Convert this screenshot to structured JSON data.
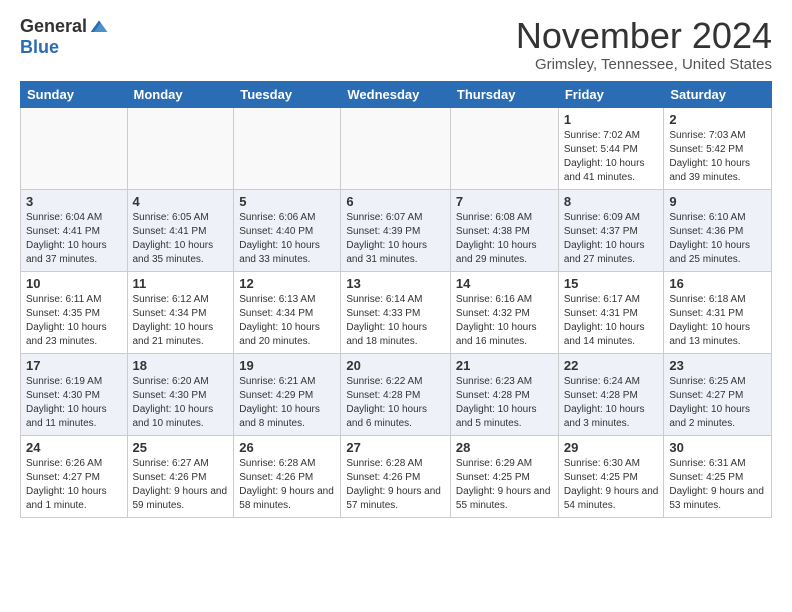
{
  "header": {
    "logo_general": "General",
    "logo_blue": "Blue",
    "month_title": "November 2024",
    "location": "Grimsley, Tennessee, United States"
  },
  "weekdays": [
    "Sunday",
    "Monday",
    "Tuesday",
    "Wednesday",
    "Thursday",
    "Friday",
    "Saturday"
  ],
  "weeks": [
    [
      {
        "day": "",
        "info": ""
      },
      {
        "day": "",
        "info": ""
      },
      {
        "day": "",
        "info": ""
      },
      {
        "day": "",
        "info": ""
      },
      {
        "day": "",
        "info": ""
      },
      {
        "day": "1",
        "info": "Sunrise: 7:02 AM\nSunset: 5:44 PM\nDaylight: 10 hours and 41 minutes."
      },
      {
        "day": "2",
        "info": "Sunrise: 7:03 AM\nSunset: 5:42 PM\nDaylight: 10 hours and 39 minutes."
      }
    ],
    [
      {
        "day": "3",
        "info": "Sunrise: 6:04 AM\nSunset: 4:41 PM\nDaylight: 10 hours and 37 minutes."
      },
      {
        "day": "4",
        "info": "Sunrise: 6:05 AM\nSunset: 4:41 PM\nDaylight: 10 hours and 35 minutes."
      },
      {
        "day": "5",
        "info": "Sunrise: 6:06 AM\nSunset: 4:40 PM\nDaylight: 10 hours and 33 minutes."
      },
      {
        "day": "6",
        "info": "Sunrise: 6:07 AM\nSunset: 4:39 PM\nDaylight: 10 hours and 31 minutes."
      },
      {
        "day": "7",
        "info": "Sunrise: 6:08 AM\nSunset: 4:38 PM\nDaylight: 10 hours and 29 minutes."
      },
      {
        "day": "8",
        "info": "Sunrise: 6:09 AM\nSunset: 4:37 PM\nDaylight: 10 hours and 27 minutes."
      },
      {
        "day": "9",
        "info": "Sunrise: 6:10 AM\nSunset: 4:36 PM\nDaylight: 10 hours and 25 minutes."
      }
    ],
    [
      {
        "day": "10",
        "info": "Sunrise: 6:11 AM\nSunset: 4:35 PM\nDaylight: 10 hours and 23 minutes."
      },
      {
        "day": "11",
        "info": "Sunrise: 6:12 AM\nSunset: 4:34 PM\nDaylight: 10 hours and 21 minutes."
      },
      {
        "day": "12",
        "info": "Sunrise: 6:13 AM\nSunset: 4:34 PM\nDaylight: 10 hours and 20 minutes."
      },
      {
        "day": "13",
        "info": "Sunrise: 6:14 AM\nSunset: 4:33 PM\nDaylight: 10 hours and 18 minutes."
      },
      {
        "day": "14",
        "info": "Sunrise: 6:16 AM\nSunset: 4:32 PM\nDaylight: 10 hours and 16 minutes."
      },
      {
        "day": "15",
        "info": "Sunrise: 6:17 AM\nSunset: 4:31 PM\nDaylight: 10 hours and 14 minutes."
      },
      {
        "day": "16",
        "info": "Sunrise: 6:18 AM\nSunset: 4:31 PM\nDaylight: 10 hours and 13 minutes."
      }
    ],
    [
      {
        "day": "17",
        "info": "Sunrise: 6:19 AM\nSunset: 4:30 PM\nDaylight: 10 hours and 11 minutes."
      },
      {
        "day": "18",
        "info": "Sunrise: 6:20 AM\nSunset: 4:30 PM\nDaylight: 10 hours and 10 minutes."
      },
      {
        "day": "19",
        "info": "Sunrise: 6:21 AM\nSunset: 4:29 PM\nDaylight: 10 hours and 8 minutes."
      },
      {
        "day": "20",
        "info": "Sunrise: 6:22 AM\nSunset: 4:28 PM\nDaylight: 10 hours and 6 minutes."
      },
      {
        "day": "21",
        "info": "Sunrise: 6:23 AM\nSunset: 4:28 PM\nDaylight: 10 hours and 5 minutes."
      },
      {
        "day": "22",
        "info": "Sunrise: 6:24 AM\nSunset: 4:28 PM\nDaylight: 10 hours and 3 minutes."
      },
      {
        "day": "23",
        "info": "Sunrise: 6:25 AM\nSunset: 4:27 PM\nDaylight: 10 hours and 2 minutes."
      }
    ],
    [
      {
        "day": "24",
        "info": "Sunrise: 6:26 AM\nSunset: 4:27 PM\nDaylight: 10 hours and 1 minute."
      },
      {
        "day": "25",
        "info": "Sunrise: 6:27 AM\nSunset: 4:26 PM\nDaylight: 9 hours and 59 minutes."
      },
      {
        "day": "26",
        "info": "Sunrise: 6:28 AM\nSunset: 4:26 PM\nDaylight: 9 hours and 58 minutes."
      },
      {
        "day": "27",
        "info": "Sunrise: 6:28 AM\nSunset: 4:26 PM\nDaylight: 9 hours and 57 minutes."
      },
      {
        "day": "28",
        "info": "Sunrise: 6:29 AM\nSunset: 4:25 PM\nDaylight: 9 hours and 55 minutes."
      },
      {
        "day": "29",
        "info": "Sunrise: 6:30 AM\nSunset: 4:25 PM\nDaylight: 9 hours and 54 minutes."
      },
      {
        "day": "30",
        "info": "Sunrise: 6:31 AM\nSunset: 4:25 PM\nDaylight: 9 hours and 53 minutes."
      }
    ]
  ]
}
